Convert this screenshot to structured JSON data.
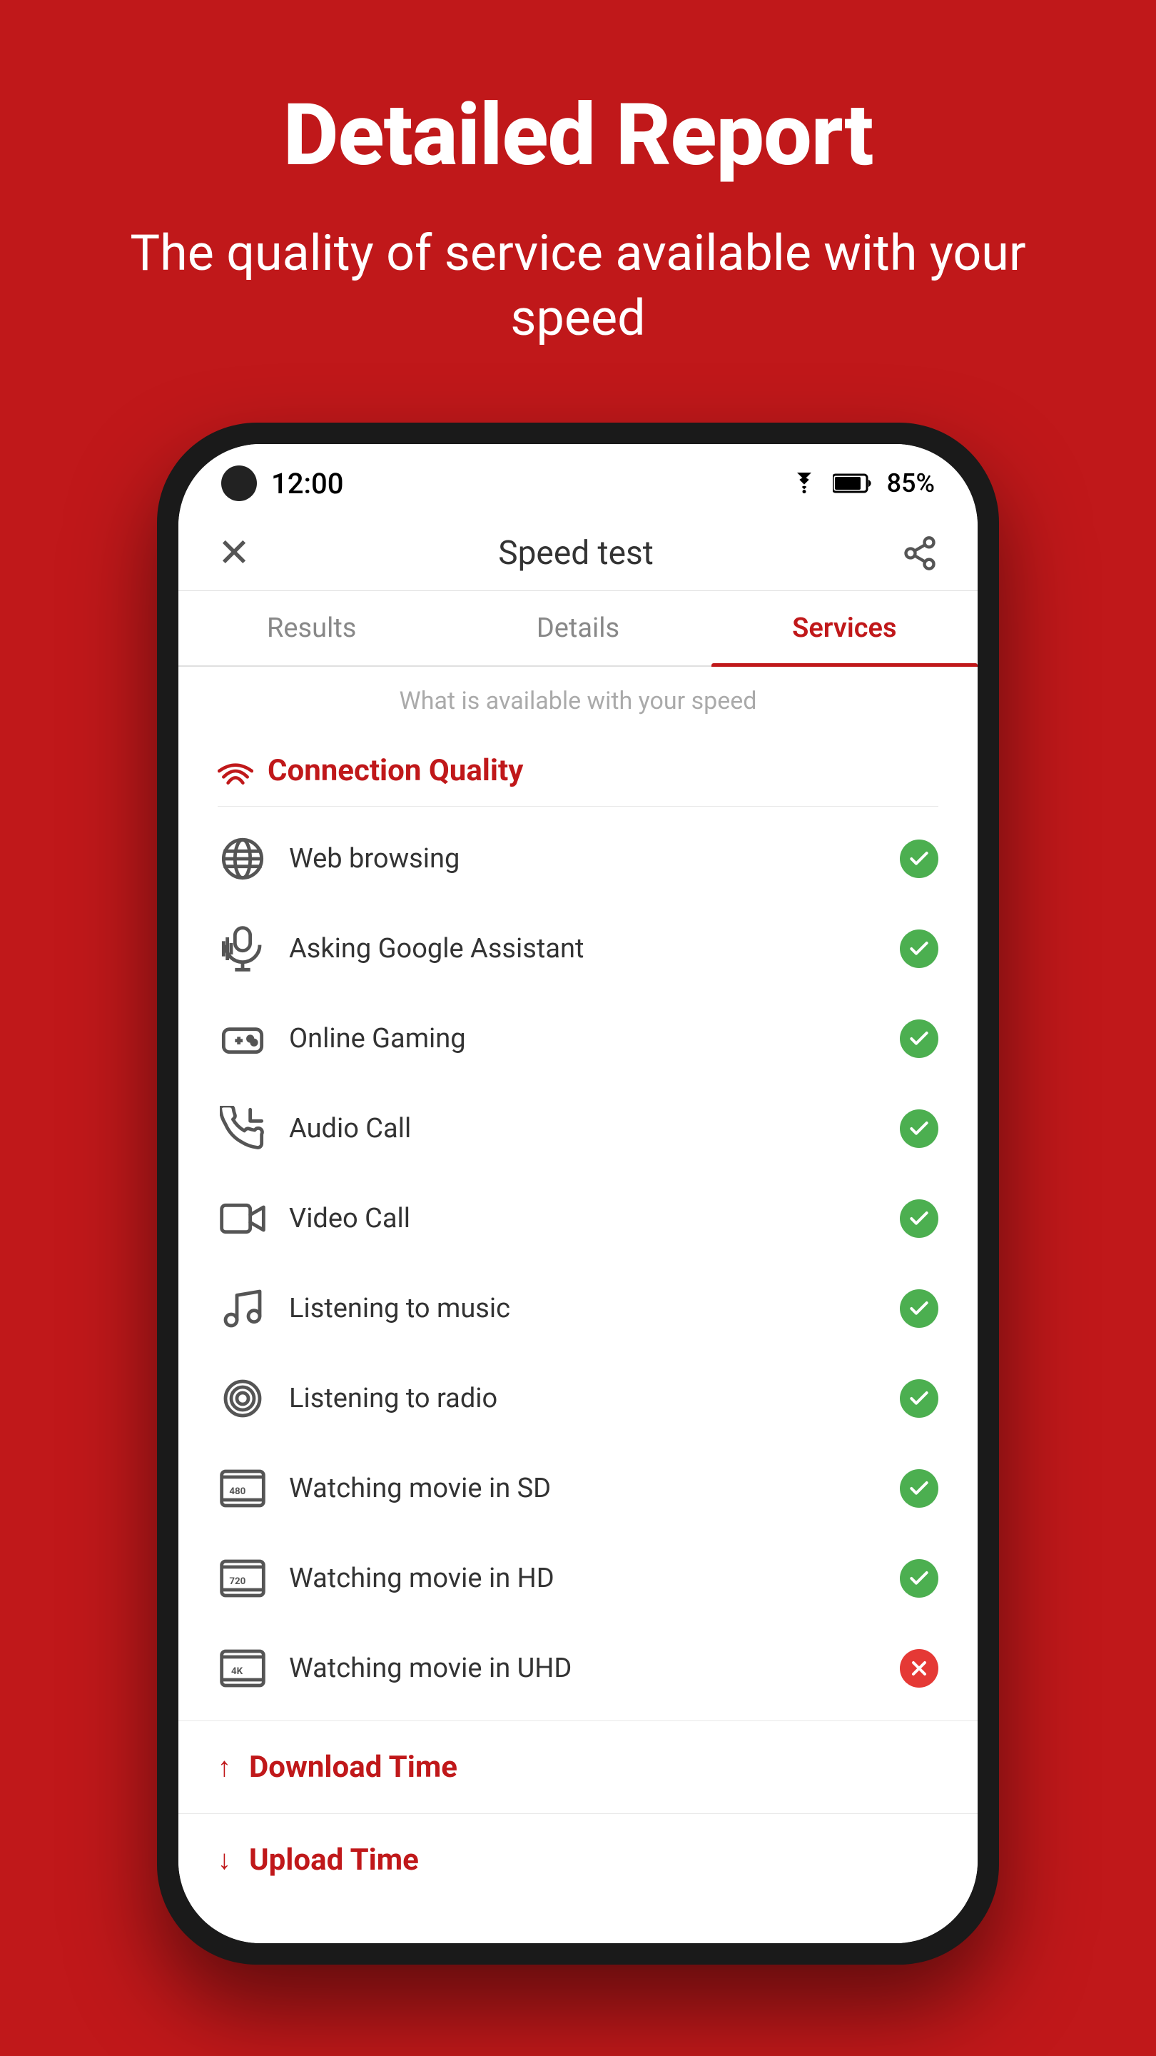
{
  "page": {
    "background_color": "#c0181a",
    "header": {
      "title": "Detailed Report",
      "subtitle": "The quality of service available with your speed"
    }
  },
  "status_bar": {
    "time": "12:00",
    "battery": "85%"
  },
  "app_bar": {
    "title": "Speed test",
    "close_label": "×"
  },
  "tabs": [
    {
      "label": "Results",
      "active": false
    },
    {
      "label": "Details",
      "active": false
    },
    {
      "label": "Services",
      "active": true
    }
  ],
  "tab_subtitle": "What is available with your speed",
  "connection_quality": {
    "section_title": "Connection Quality",
    "items": [
      {
        "name": "Web browsing",
        "icon": "www",
        "status": "ok"
      },
      {
        "name": "Asking Google Assistant",
        "icon": "mic",
        "status": "ok"
      },
      {
        "name": "Online Gaming",
        "icon": "game",
        "status": "ok"
      },
      {
        "name": "Audio Call",
        "icon": "phone",
        "status": "ok"
      },
      {
        "name": "Video Call",
        "icon": "video",
        "status": "ok"
      },
      {
        "name": "Listening to music",
        "icon": "music",
        "status": "ok"
      },
      {
        "name": "Listening to radio",
        "icon": "radio",
        "status": "ok"
      },
      {
        "name": "Watching movie in SD",
        "icon": "sd",
        "status": "ok"
      },
      {
        "name": "Watching movie in HD",
        "icon": "hd",
        "status": "ok"
      },
      {
        "name": "Watching movie in UHD",
        "icon": "uhd",
        "status": "fail"
      }
    ]
  },
  "expandable_rows": [
    {
      "label": "Download Time",
      "arrow": "↑"
    },
    {
      "label": "Upload Time",
      "arrow": "↓"
    }
  ]
}
